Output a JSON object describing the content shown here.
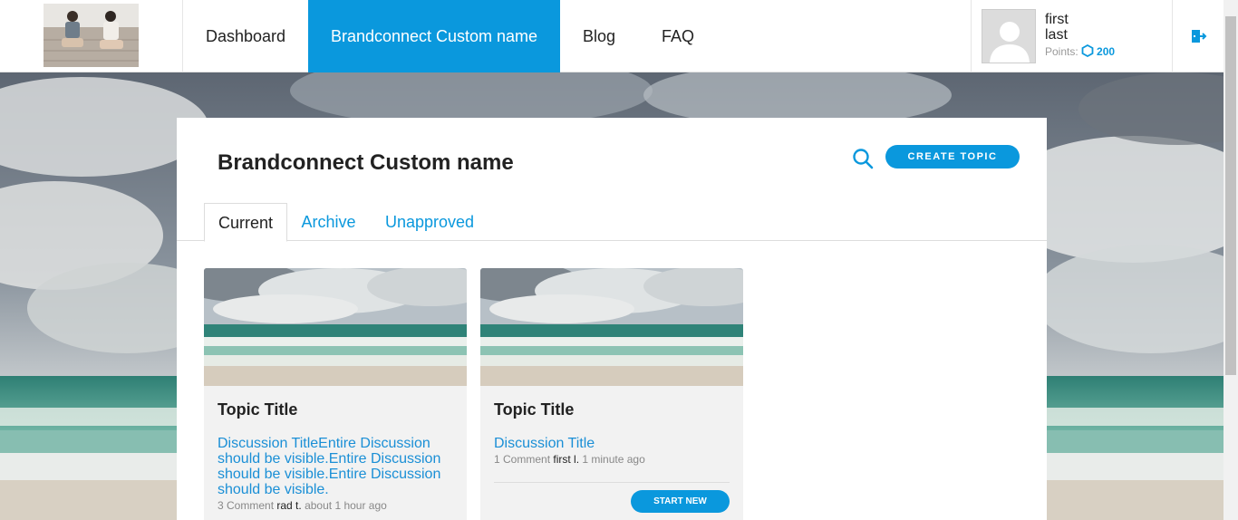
{
  "nav": {
    "items": [
      {
        "label": "Dashboard",
        "active": false
      },
      {
        "label": "Brandconnect Custom name",
        "active": true
      },
      {
        "label": "Blog",
        "active": false
      },
      {
        "label": "FAQ",
        "active": false
      }
    ]
  },
  "user": {
    "first": "first",
    "last": "last",
    "points_label": "Points:",
    "points_value": "200"
  },
  "panel": {
    "title": "Brandconnect Custom name",
    "create_label": "CREATE TOPIC",
    "tabs": [
      {
        "label": "Current",
        "active": true
      },
      {
        "label": "Archive",
        "active": false
      },
      {
        "label": "Unapproved",
        "active": false
      }
    ]
  },
  "topics": [
    {
      "title": "Topic Title",
      "discussion": "Discussion TitleEntire Discussion should be visible.Entire Discussion should be visible.Entire Discussion should be visible.",
      "comments": "3 Comment",
      "author": "rad t.",
      "time": "about 1 hour ago"
    },
    {
      "title": "Topic Title",
      "discussion": "Discussion Title",
      "comments": "1 Comment",
      "author": "first l.",
      "time": "1 minute ago",
      "button_label": "START NEW"
    }
  ],
  "colors": {
    "accent": "#0a98dd",
    "link": "#1a8fd6"
  },
  "icons": [
    "search-icon",
    "logout-icon",
    "points-hexagon-icon",
    "avatar-placeholder-icon"
  ]
}
